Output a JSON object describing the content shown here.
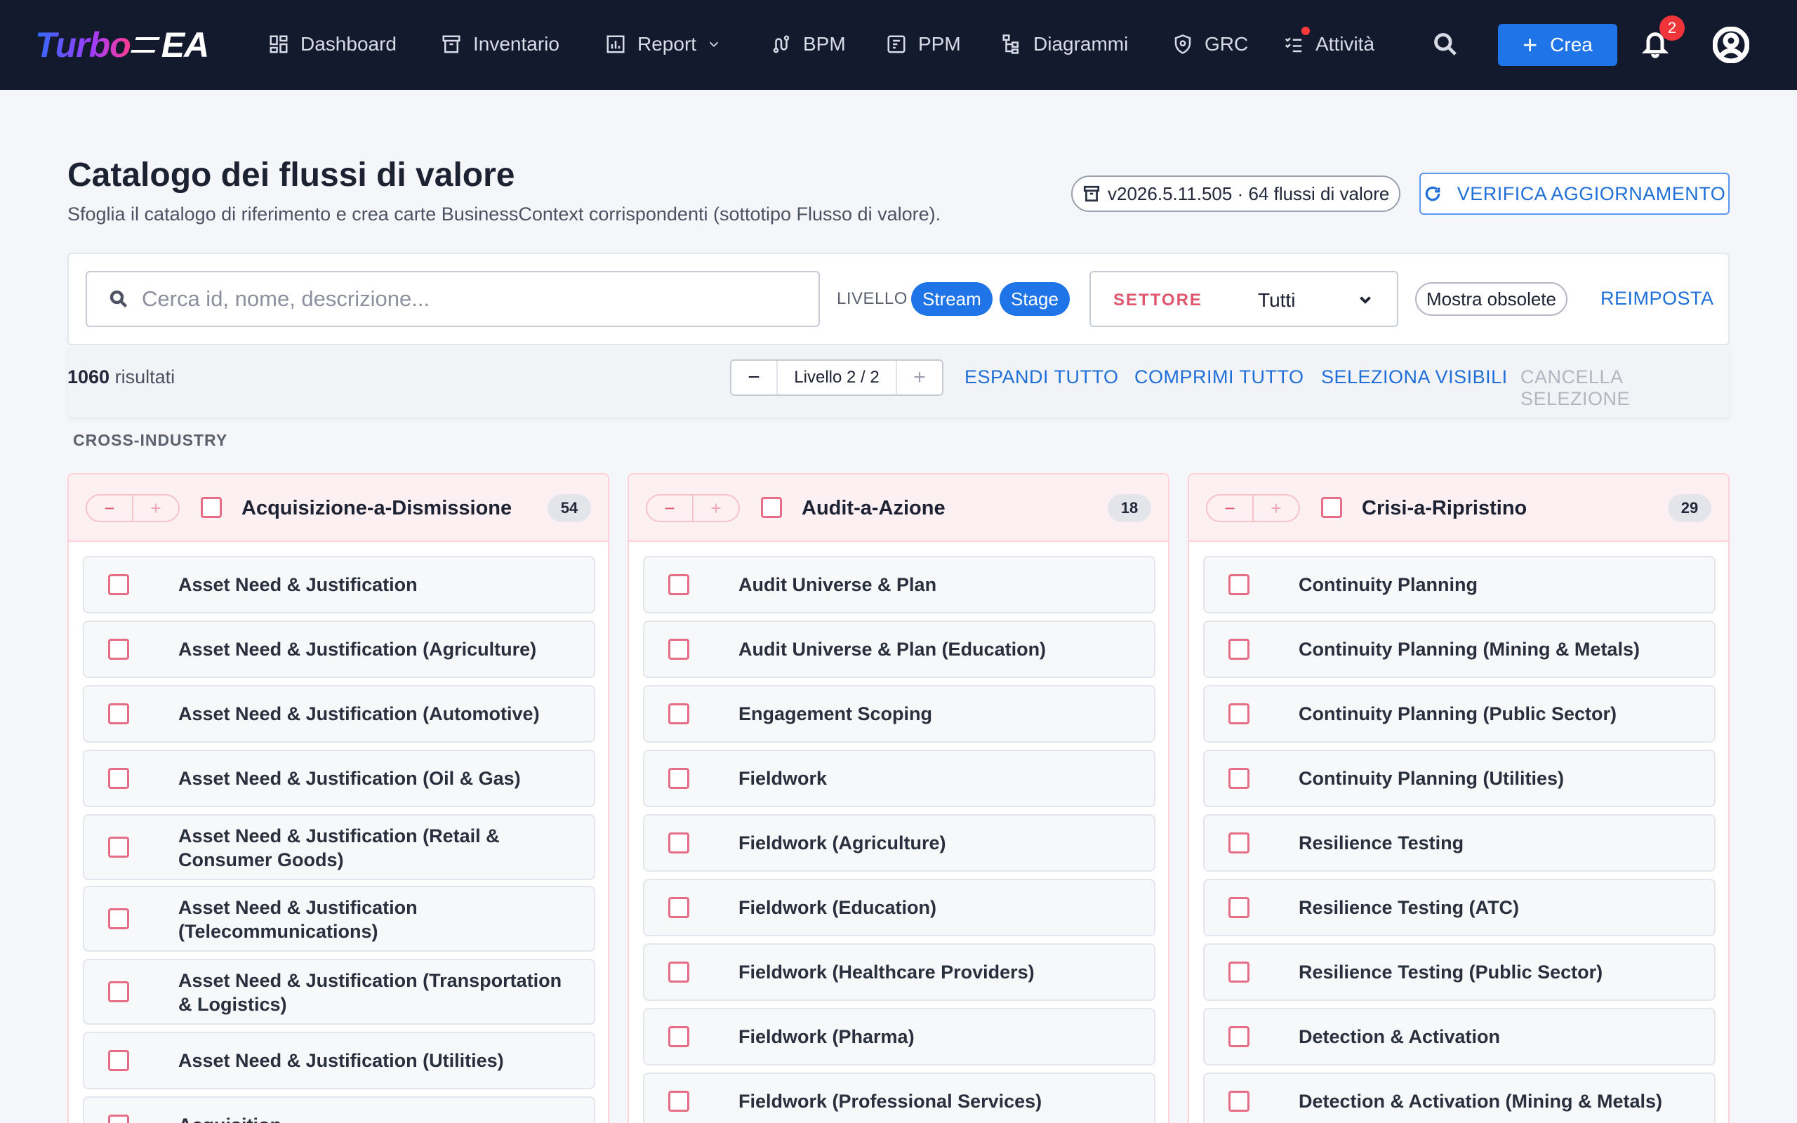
{
  "app": {
    "logo_left": "Turbo",
    "logo_right": "EA"
  },
  "nav": {
    "items": [
      {
        "label": "Dashboard",
        "icon": "dashboard-icon"
      },
      {
        "label": "Inventario",
        "icon": "archive-icon"
      },
      {
        "label": "Report",
        "icon": "bar-chart-icon"
      },
      {
        "label": "BPM",
        "icon": "route-icon"
      },
      {
        "label": "PPM",
        "icon": "project-icon"
      },
      {
        "label": "Diagrammi",
        "icon": "hierarchy-icon"
      },
      {
        "label": "GRC",
        "icon": "shield-icon"
      },
      {
        "label": "Attività",
        "icon": "checklist-icon"
      }
    ],
    "create_label": "Crea",
    "notification_count": "2"
  },
  "header": {
    "title": "Catalogo dei flussi di valore",
    "subtitle": "Sfoglia il catalogo di riferimento e crea carte BusinessContext corrispondenti (sottotipo Flusso di valore).",
    "version": "v2026.5.11.505 · 64 flussi di valore",
    "verify_label": "VERIFICA AGGIORNAMENTO"
  },
  "filters": {
    "search_placeholder": "Cerca id, nome, descrizione...",
    "level_label": "LIVELLO",
    "level_chips": [
      "Stream",
      "Stage"
    ],
    "sector_label": "SETTORE",
    "sector_value": "Tutti",
    "obsolete_label": "Mostra obsolete",
    "reset_label": "REIMPOSTA"
  },
  "results": {
    "count": "1060",
    "count_suffix": "risultati",
    "level_display": "Livello 2 / 2",
    "expand_all": "ESPANDI TUTTO",
    "collapse_all": "COMPRIMI TUTTO",
    "select_visible": "SELEZIONA VISIBILI",
    "clear_selection": "CANCELLA SELEZIONE"
  },
  "group": {
    "title": "CROSS-INDUSTRY"
  },
  "columns": [
    {
      "title": "Acquisizione-a-Dismissione",
      "count": "54",
      "items": [
        "Asset Need & Justification",
        "Asset Need & Justification (Agriculture)",
        "Asset Need & Justification (Automotive)",
        "Asset Need & Justification (Oil & Gas)",
        "Asset Need & Justification (Retail & Consumer Goods)",
        "Asset Need & Justification (Telecommunications)",
        "Asset Need & Justification (Transportation & Logistics)",
        "Asset Need & Justification (Utilities)",
        "Acquisition"
      ]
    },
    {
      "title": "Audit-a-Azione",
      "count": "18",
      "items": [
        "Audit Universe & Plan",
        "Audit Universe & Plan (Education)",
        "Engagement Scoping",
        "Fieldwork",
        "Fieldwork (Agriculture)",
        "Fieldwork (Education)",
        "Fieldwork (Healthcare Providers)",
        "Fieldwork (Pharma)",
        "Fieldwork (Professional Services)"
      ]
    },
    {
      "title": "Crisi-a-Ripristino",
      "count": "29",
      "items": [
        "Continuity Planning",
        "Continuity Planning (Mining & Metals)",
        "Continuity Planning (Public Sector)",
        "Continuity Planning (Utilities)",
        "Resilience Testing",
        "Resilience Testing (ATC)",
        "Resilience Testing (Public Sector)",
        "Detection & Activation",
        "Detection & Activation (Mining & Metals)"
      ]
    }
  ]
}
